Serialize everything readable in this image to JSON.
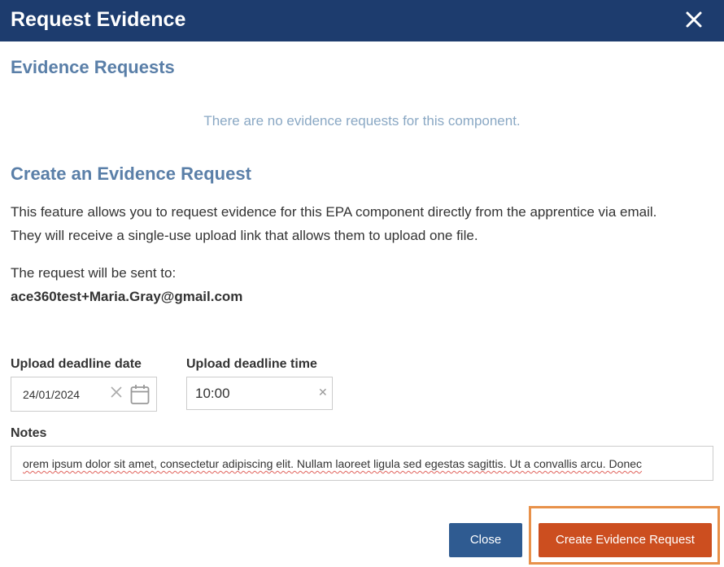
{
  "dialog": {
    "title": "Request Evidence"
  },
  "evidence_requests": {
    "heading": "Evidence Requests",
    "empty_message": "There are no evidence requests for this component."
  },
  "create_request": {
    "heading": "Create an Evidence Request",
    "description_line1": "This feature allows you to request evidence for this EPA component directly from the apprentice via email.",
    "description_line2": "They will receive a single-use upload link that allows them to upload one file.",
    "sent_to_label": "The request will be sent to:",
    "recipient_email": "ace360test+Maria.Gray@gmail.com"
  },
  "form": {
    "deadline_date_label": "Upload deadline date",
    "deadline_date_value": "24/01/2024",
    "deadline_time_label": "Upload deadline time",
    "deadline_time_value": "10:00",
    "notes_label": "Notes",
    "notes_value": "orem ipsum dolor sit amet, consectetur adipiscing elit. Nullam laoreet ligula sed egestas sagittis. Ut a convallis arcu. Donec"
  },
  "buttons": {
    "close_label": "Close",
    "create_label": "Create Evidence Request"
  },
  "colors": {
    "header_bg": "#1d3c6e",
    "heading_text": "#5a7fa8",
    "close_button": "#2f5b91",
    "create_button": "#cc4e1f",
    "highlight_border": "#e8914a"
  }
}
